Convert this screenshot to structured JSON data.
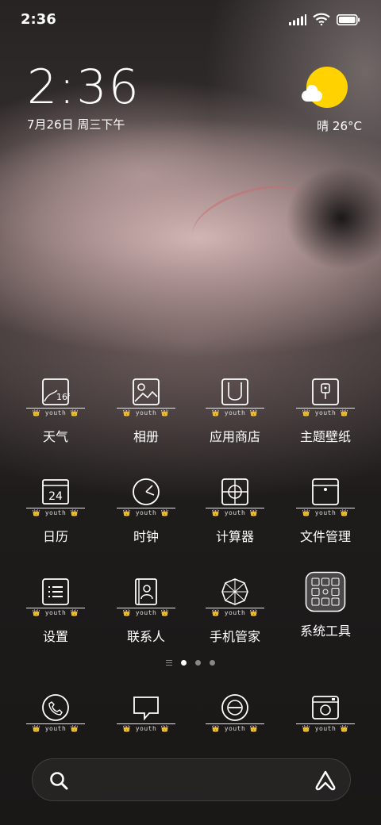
{
  "status_bar": {
    "time": "2:36",
    "icons": [
      "signal-icon",
      "wifi-icon",
      "battery-icon"
    ]
  },
  "clock_widget": {
    "time": "2:36",
    "date": "7月26日 周三下午"
  },
  "weather_widget": {
    "condition_temp": "晴 26°C",
    "icon": "sunny-cloud-icon",
    "sun_color": "#ffd200"
  },
  "theme_tag": {
    "text": "youth",
    "crown": "👑",
    "crown_color": "#f2c200"
  },
  "apps": [
    {
      "label": "天气",
      "icon": "weather-icon",
      "icon_text": "16°"
    },
    {
      "label": "相册",
      "icon": "gallery-icon"
    },
    {
      "label": "应用商店",
      "icon": "app-store-icon"
    },
    {
      "label": "主题壁纸",
      "icon": "theme-wallpaper-icon"
    },
    {
      "label": "日历",
      "icon": "calendar-icon",
      "icon_text": "24"
    },
    {
      "label": "时钟",
      "icon": "clock-icon"
    },
    {
      "label": "计算器",
      "icon": "calculator-icon"
    },
    {
      "label": "文件管理",
      "icon": "file-manager-icon"
    },
    {
      "label": "设置",
      "icon": "settings-icon"
    },
    {
      "label": "联系人",
      "icon": "contacts-icon"
    },
    {
      "label": "手机管家",
      "icon": "security-icon"
    },
    {
      "label": "系统工具",
      "icon": "system-tools-folder-icon"
    }
  ],
  "page_indicator": {
    "pages": 3,
    "active": 1
  },
  "dock": [
    {
      "icon": "phone-icon"
    },
    {
      "icon": "messages-icon"
    },
    {
      "icon": "browser-icon"
    },
    {
      "icon": "camera-icon"
    }
  ],
  "search_bar": {
    "left_icon": "search-icon",
    "right_icon": "assistant-icon"
  }
}
